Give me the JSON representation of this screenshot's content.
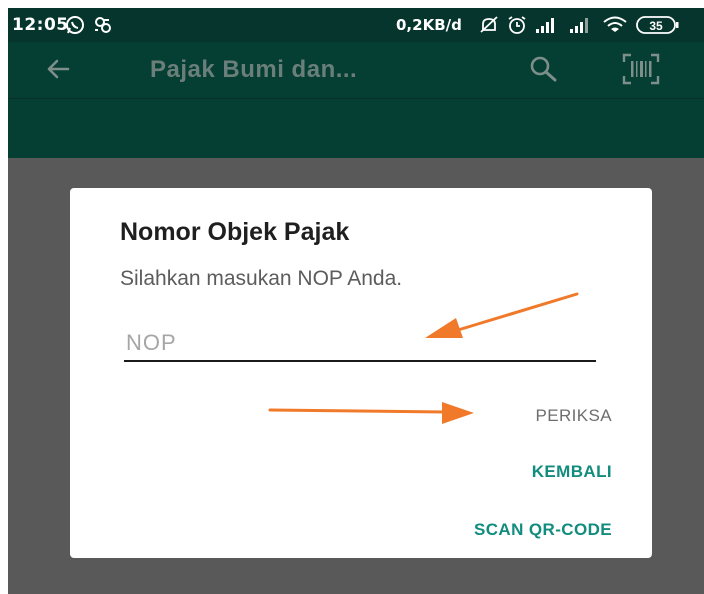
{
  "status_bar": {
    "time": "12:05",
    "net_speed": "0,2KB/d",
    "battery": "35"
  },
  "app_bar": {
    "title": "Pajak Bumi dan...",
    "back_icon": "arrow-left-icon",
    "search_icon": "search-icon",
    "scan_icon": "barcode-scan-icon"
  },
  "dialog": {
    "title": "Nomor Objek Pajak",
    "message": "Silahkan masukan NOP Anda.",
    "input": {
      "placeholder": "NOP",
      "value": ""
    },
    "buttons": {
      "periksa": "PERIKSA",
      "kembali": "KEMBALI",
      "scan_qr": "SCAN QR-CODE"
    }
  },
  "colors": {
    "status_bar": "#05352c",
    "app_bar": "#053e33",
    "scrim": "#595959",
    "accent": "#128c7e",
    "annotation_arrow": "#f07a2a"
  }
}
